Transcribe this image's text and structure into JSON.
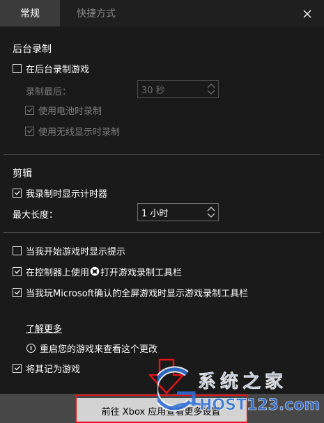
{
  "tabs": [
    {
      "label": "常规",
      "selected": true
    },
    {
      "label": "快捷方式",
      "selected": false
    }
  ],
  "background_recording": {
    "heading": "后台录制",
    "record_in_background": {
      "label": "在后台录制游戏",
      "checked": false
    },
    "record_last": {
      "label": "录制最后：",
      "value": "30 秒"
    },
    "record_on_battery": {
      "label": "使用电池时录制",
      "checked": true
    },
    "record_wireless_display": {
      "label": "使用无线显示时录制",
      "checked": true
    }
  },
  "clips": {
    "heading": "剪辑",
    "show_timer": {
      "label": "我录制时显示计时器",
      "checked": true
    },
    "max_length": {
      "label": "最大长度：",
      "value": "1 小时"
    }
  },
  "options": [
    {
      "label": "当我开始游戏时显示提示",
      "checked": false
    },
    {
      "label_before": "在控制器上使用",
      "label_after": "打开游戏录制工具栏",
      "checked": true
    },
    {
      "label": "当我玩Microsoft确认的全屏游戏时显示游戏录制工具栏",
      "checked": true
    }
  ],
  "learn_more": "了解更多",
  "restart_notice": "重启您的游戏来查看这个更改",
  "remember_as_game": {
    "label": "将其记为游戏",
    "checked": true
  },
  "footer_button": "前往 Xbox 应用查看更多设置",
  "watermark": {
    "text_cn": "系统之家",
    "text_en": "HOST123.com"
  },
  "colors": {
    "accent_highlight": "#e0141a",
    "watermark_blue": "#2f6fd6",
    "panel_bg": "#1a1a1a",
    "tab_bg": "#3b3b3b"
  },
  "icons": {
    "close": "close-icon",
    "xbox": "xbox-logo-icon",
    "info": "info-icon",
    "arrow": "down-arrow-icon",
    "checkbox": "checkmark-icon"
  }
}
